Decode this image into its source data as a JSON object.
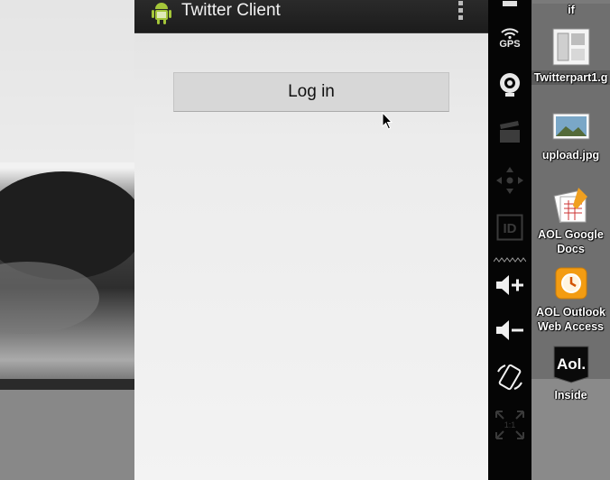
{
  "app": {
    "title": "Twitter Client",
    "login_button_label": "Log in"
  },
  "emulator_controls": {
    "gps_label": "GPS",
    "items": [
      "power-icon",
      "gps-icon",
      "webcam-icon",
      "clapper-icon",
      "dpad-icon",
      "id-icon",
      "volume-up-icon",
      "volume-down-icon",
      "rotate-icon",
      "scale-icon"
    ]
  },
  "desktop_icons": [
    {
      "name": "twitterpart2-gif",
      "label": "if"
    },
    {
      "name": "twitterpart1-gif",
      "label": "Twitterpart1.g"
    },
    {
      "name": "upload-jpg",
      "label": "upload.jpg"
    },
    {
      "name": "aol-google-docs",
      "label_lines": [
        "AOL Google",
        "Docs"
      ]
    },
    {
      "name": "aol-outlook-web-access",
      "label_lines": [
        "AOL Outlook",
        "Web Access"
      ]
    },
    {
      "name": "aol-inside",
      "label": "Inside"
    }
  ],
  "colors": {
    "action_bar": "#1c1c1c",
    "android_green": "#a4c639",
    "control_strip": "#050505",
    "app_background": "#ececec"
  }
}
